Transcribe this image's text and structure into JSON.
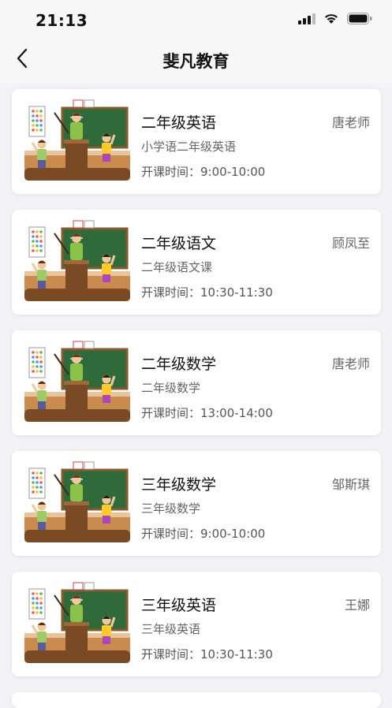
{
  "status_bar": {
    "time": "21:13"
  },
  "nav": {
    "title": "斐凡教育"
  },
  "courses": [
    {
      "title": "二年级英语",
      "teacher": "唐老师",
      "description": "小学语二年级英语",
      "time_label": "开课时间：",
      "time": "9:00-10:00"
    },
    {
      "title": "二年级语文",
      "teacher": "顾凤至",
      "description": "二年级语文课",
      "time_label": "开课时间：",
      "time": "10:30-11:30"
    },
    {
      "title": "二年级数学",
      "teacher": "唐老师",
      "description": "二年级数学",
      "time_label": "开课时间：",
      "time": "13:00-14:00"
    },
    {
      "title": "三年级数学",
      "teacher": "邹斯琪",
      "description": "三年级数学",
      "time_label": "开课时间：",
      "time": "9:00-10:00"
    },
    {
      "title": "三年级英语",
      "teacher": "王娜",
      "description": "三年级英语",
      "time_label": "开课时间：",
      "time": "10:30-11:30"
    }
  ],
  "icons": {
    "back": "chevron-left-icon",
    "signal": "cellular-signal-icon",
    "wifi": "wifi-icon",
    "battery": "battery-icon",
    "thumbnail": "classroom-illustration"
  }
}
